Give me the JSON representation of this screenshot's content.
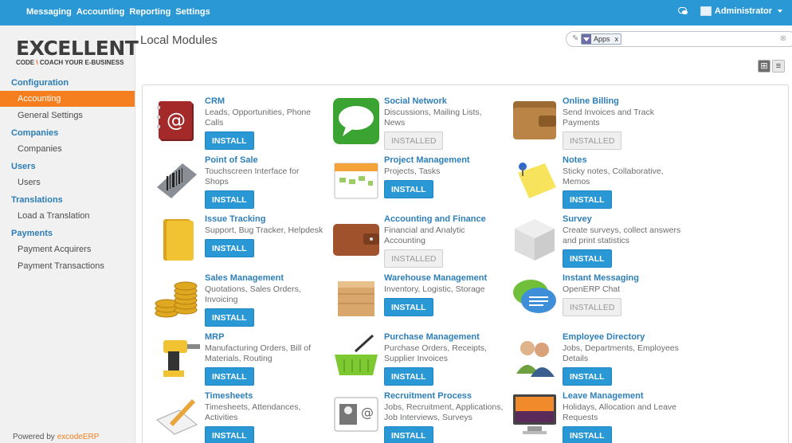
{
  "topbar": {
    "menu": [
      "Messaging",
      "Accounting",
      "Reporting",
      "Settings"
    ],
    "user": "Administrator",
    "chat_icon": "chat-icon"
  },
  "sidebar": {
    "logo": {
      "main": "EXCELLENT",
      "sub1": "CODE",
      "sub2": "COACH YOUR E-BUSINESS"
    },
    "sections": [
      {
        "title": "Configuration",
        "items": [
          "Accounting",
          "General Settings"
        ]
      },
      {
        "title": "Companies",
        "items": [
          "Companies"
        ]
      },
      {
        "title": "Users",
        "items": [
          "Users"
        ]
      },
      {
        "title": "Translations",
        "items": [
          "Load a Translation"
        ]
      },
      {
        "title": "Payments",
        "items": [
          "Payment Acquirers",
          "Payment Transactions"
        ]
      }
    ],
    "active_item": "Accounting",
    "powered_prefix": "Powered by",
    "powered_brand": "excodeERP"
  },
  "main": {
    "title": "Local Modules",
    "search": {
      "facet": "Apps",
      "facet_remove": "x"
    }
  },
  "modules": [
    {
      "name": "CRM",
      "desc": "Leads, Opportunities, Phone Calls",
      "status": "INSTALL",
      "icon": "address-book-icon"
    },
    {
      "name": "Social Network",
      "desc": "Discussions, Mailing Lists, News",
      "status": "INSTALLED",
      "icon": "speech-bubble-icon"
    },
    {
      "name": "Online Billing",
      "desc": "Send Invoices and Track Payments",
      "status": "INSTALLED",
      "icon": "wallet-icon"
    },
    {
      "name": "Point of Sale",
      "desc": "Touchscreen Interface for Shops",
      "status": "INSTALL",
      "icon": "barcode-scanner-icon"
    },
    {
      "name": "Project Management",
      "desc": "Projects, Tasks",
      "status": "INSTALL",
      "icon": "calendar-icon"
    },
    {
      "name": "Notes",
      "desc": "Sticky notes, Collaborative, Memos",
      "status": "INSTALL",
      "icon": "sticky-note-icon"
    },
    {
      "name": "Issue Tracking",
      "desc": "Support, Bug Tracker, Helpdesk",
      "status": "INSTALL",
      "icon": "folder-icon"
    },
    {
      "name": "Accounting and Finance",
      "desc": "Financial and Analytic Accounting",
      "status": "INSTALLED",
      "icon": "wallet-brown-icon"
    },
    {
      "name": "Survey",
      "desc": "Create surveys, collect answers and print statistics",
      "status": "INSTALL",
      "icon": "cube-icon"
    },
    {
      "name": "Sales Management",
      "desc": "Quotations, Sales Orders, Invoicing",
      "status": "INSTALL",
      "icon": "coins-icon"
    },
    {
      "name": "Warehouse Management",
      "desc": "Inventory, Logistic, Storage",
      "status": "INSTALL",
      "icon": "crate-icon"
    },
    {
      "name": "Instant Messaging",
      "desc": "OpenERP Chat",
      "status": "INSTALLED",
      "icon": "chat-bubbles-icon"
    },
    {
      "name": "MRP",
      "desc": "Manufacturing Orders, Bill of Materials, Routing",
      "status": "INSTALL",
      "icon": "drill-icon"
    },
    {
      "name": "Purchase Management",
      "desc": "Purchase Orders, Receipts, Supplier Invoices",
      "status": "INSTALL",
      "icon": "basket-icon"
    },
    {
      "name": "Employee Directory",
      "desc": "Jobs, Departments, Employees Details",
      "status": "INSTALL",
      "icon": "people-icon"
    },
    {
      "name": "Timesheets",
      "desc": "Timesheets, Attendances, Activities",
      "status": "INSTALL",
      "icon": "pen-paper-icon"
    },
    {
      "name": "Recruitment Process",
      "desc": "Jobs, Recruitment, Applications, Job Interviews, Surveys",
      "status": "INSTALL",
      "icon": "id-card-icon"
    },
    {
      "name": "Leave Management",
      "desc": "Holidays, Allocation and Leave Requests",
      "status": "INSTALL",
      "icon": "monitor-sunset-icon"
    }
  ]
}
